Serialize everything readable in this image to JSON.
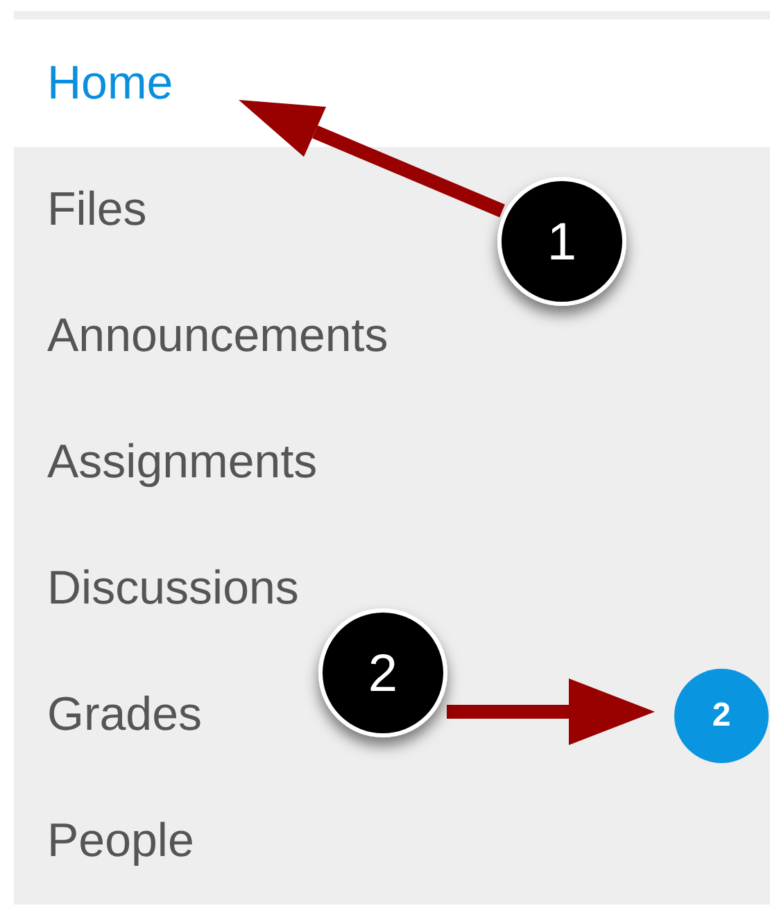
{
  "nav": {
    "items": [
      {
        "label": "Home",
        "selected": true
      },
      {
        "label": "Files",
        "selected": false
      },
      {
        "label": "Announcements",
        "selected": false
      },
      {
        "label": "Assignments",
        "selected": false
      },
      {
        "label": "Discussions",
        "selected": false
      },
      {
        "label": "Grades",
        "selected": false,
        "badge": "2"
      },
      {
        "label": "People",
        "selected": false
      }
    ]
  },
  "callouts": [
    {
      "number": "1"
    },
    {
      "number": "2"
    }
  ]
}
